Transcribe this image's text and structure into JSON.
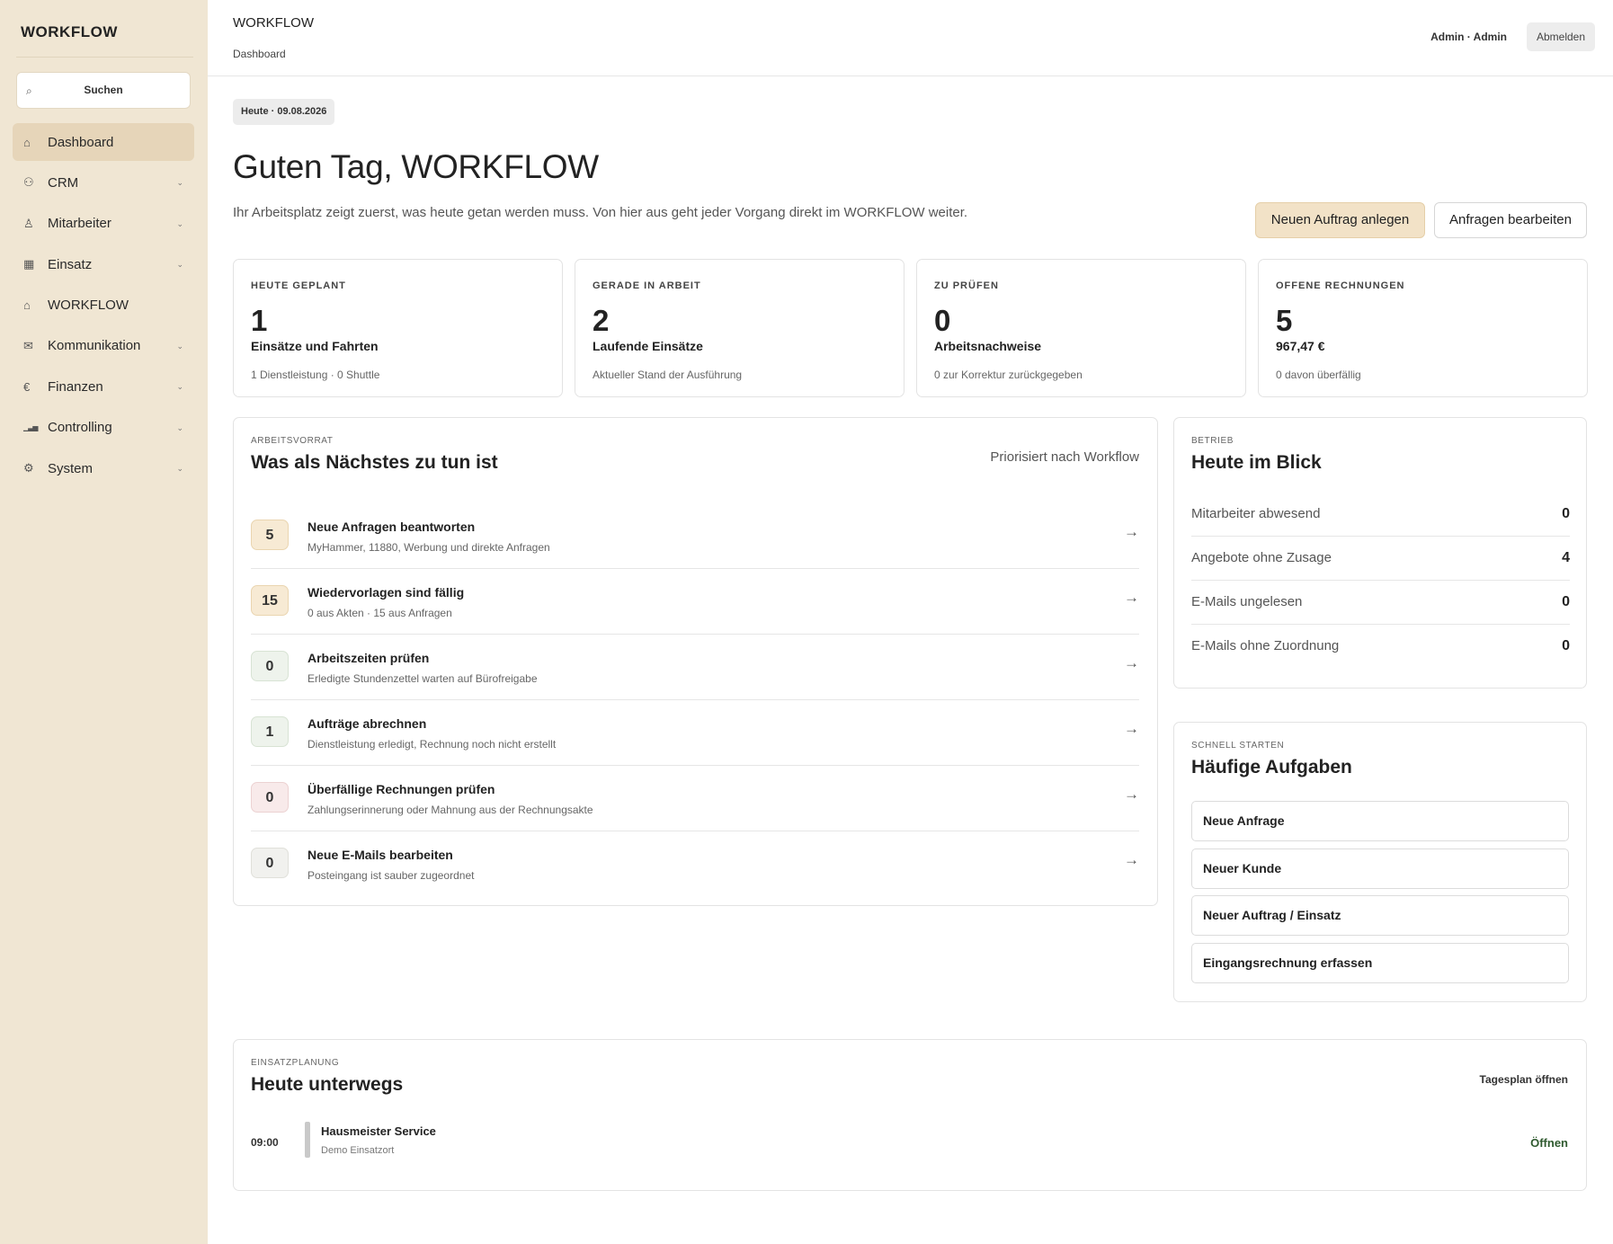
{
  "sidebar": {
    "brand": "WORKFLOW",
    "search_label": "Suchen",
    "items": [
      {
        "label": "Dashboard",
        "icon": "home-icon",
        "glyph": "⌂",
        "active": true,
        "has_children": false
      },
      {
        "label": "CRM",
        "icon": "users-icon",
        "glyph": "⚇",
        "active": false,
        "has_children": true
      },
      {
        "label": "Mitarbeiter",
        "icon": "user-icon",
        "glyph": "♙",
        "active": false,
        "has_children": true
      },
      {
        "label": "Einsatz",
        "icon": "calendar-icon",
        "glyph": "▦",
        "active": false,
        "has_children": true
      },
      {
        "label": "WORKFLOW",
        "icon": "home-icon",
        "glyph": "⌂",
        "active": false,
        "has_children": false
      },
      {
        "label": "Kommunikation",
        "icon": "mail-icon",
        "glyph": "✉",
        "active": false,
        "has_children": true
      },
      {
        "label": "Finanzen",
        "icon": "euro-icon",
        "glyph": "€",
        "active": false,
        "has_children": true
      },
      {
        "label": "Controlling",
        "icon": "bar-chart-icon",
        "glyph": "▁▃▅",
        "active": false,
        "has_children": true
      },
      {
        "label": "System",
        "icon": "gear-icon",
        "glyph": "⚙",
        "active": false,
        "has_children": true
      }
    ]
  },
  "header": {
    "title": "WORKFLOW",
    "breadcrumb": "Dashboard",
    "user": "Admin · Admin",
    "logout_label": "Abmelden"
  },
  "main": {
    "date_chip": "Heute · 09.08.2026",
    "greeting": "Guten Tag, WORKFLOW",
    "intro": "Ihr Arbeitsplatz zeigt zuerst, was heute getan werden muss. Von hier aus geht jeder Vorgang direkt im WORKFLOW weiter.",
    "primary_action": "Neuen Auftrag anlegen",
    "secondary_action": "Anfragen bearbeiten",
    "stats": [
      {
        "kicker": "HEUTE GEPLANT",
        "value": "1",
        "title": "Einsätze und Fahrten",
        "sub": "1 Dienstleistung · 0 Shuttle"
      },
      {
        "kicker": "GERADE IN ARBEIT",
        "value": "2",
        "title": "Laufende Einsätze",
        "sub": "Aktueller Stand der Ausführung"
      },
      {
        "kicker": "ZU PRÜFEN",
        "value": "0",
        "title": "Arbeitsnachweise",
        "sub": "0 zur Korrektur zurückgegeben"
      },
      {
        "kicker": "OFFENE RECHNUNGEN",
        "value": "5",
        "title": "967,47 €",
        "sub": "0 davon überfällig"
      }
    ],
    "backlog": {
      "eyebrow": "ARBEITSVORRAT",
      "title": "Was als Nächstes zu tun ist",
      "priority_note": "Priorisiert nach Workflow",
      "arrow": "→",
      "tasks": [
        {
          "count": "5",
          "title": "Neue Anfragen beantworten",
          "sub": "MyHammer, 11880, Werbung und direkte Anfragen",
          "tone": "#f7ead4",
          "border": "#ead5b0"
        },
        {
          "count": "15",
          "title": "Wiedervorlagen sind fällig",
          "sub": "0 aus Akten · 15 aus Anfragen",
          "tone": "#f7ead4",
          "border": "#ead5b0"
        },
        {
          "count": "0",
          "title": "Arbeitszeiten prüfen",
          "sub": "Erledigte Stundenzettel warten auf Bürofreigabe",
          "tone": "#eef3ec",
          "border": "#d8e3d4"
        },
        {
          "count": "1",
          "title": "Aufträge abrechnen",
          "sub": "Dienstleistung erledigt, Rechnung noch nicht erstellt",
          "tone": "#eef3ec",
          "border": "#d8e3d4"
        },
        {
          "count": "0",
          "title": "Überfällige Rechnungen prüfen",
          "sub": "Zahlungserinnerung oder Mahnung aus der Rechnungsakte",
          "tone": "#f8eaea",
          "border": "#ecd2d2"
        },
        {
          "count": "0",
          "title": "Neue E-Mails bearbeiten",
          "sub": "Posteingang ist sauber zugeordnet",
          "tone": "#f1f1ee",
          "border": "#e0e0da"
        }
      ]
    },
    "glance": {
      "eyebrow": "BETRIEB",
      "title": "Heute im Blick",
      "rows": [
        {
          "label": "Mitarbeiter abwesend",
          "value": "0"
        },
        {
          "label": "Angebote ohne Zusage",
          "value": "4"
        },
        {
          "label": "E-Mails ungelesen",
          "value": "0"
        },
        {
          "label": "E-Mails ohne Zuordnung",
          "value": "0"
        }
      ]
    },
    "quick": {
      "eyebrow": "SCHNELL STARTEN",
      "title": "Häufige Aufgaben",
      "buttons": [
        "Neue Anfrage",
        "Neuer Kunde",
        "Neuer Auftrag / Einsatz",
        "Eingangsrechnung erfassen"
      ]
    },
    "plan": {
      "eyebrow": "EINSATZPLANUNG",
      "title": "Heute unterwegs",
      "open_day": "Tagesplan öffnen",
      "entries": [
        {
          "time": "09:00",
          "title": "Hausmeister Service",
          "place": "Demo Einsatzort",
          "open": "Öffnen"
        }
      ]
    }
  }
}
